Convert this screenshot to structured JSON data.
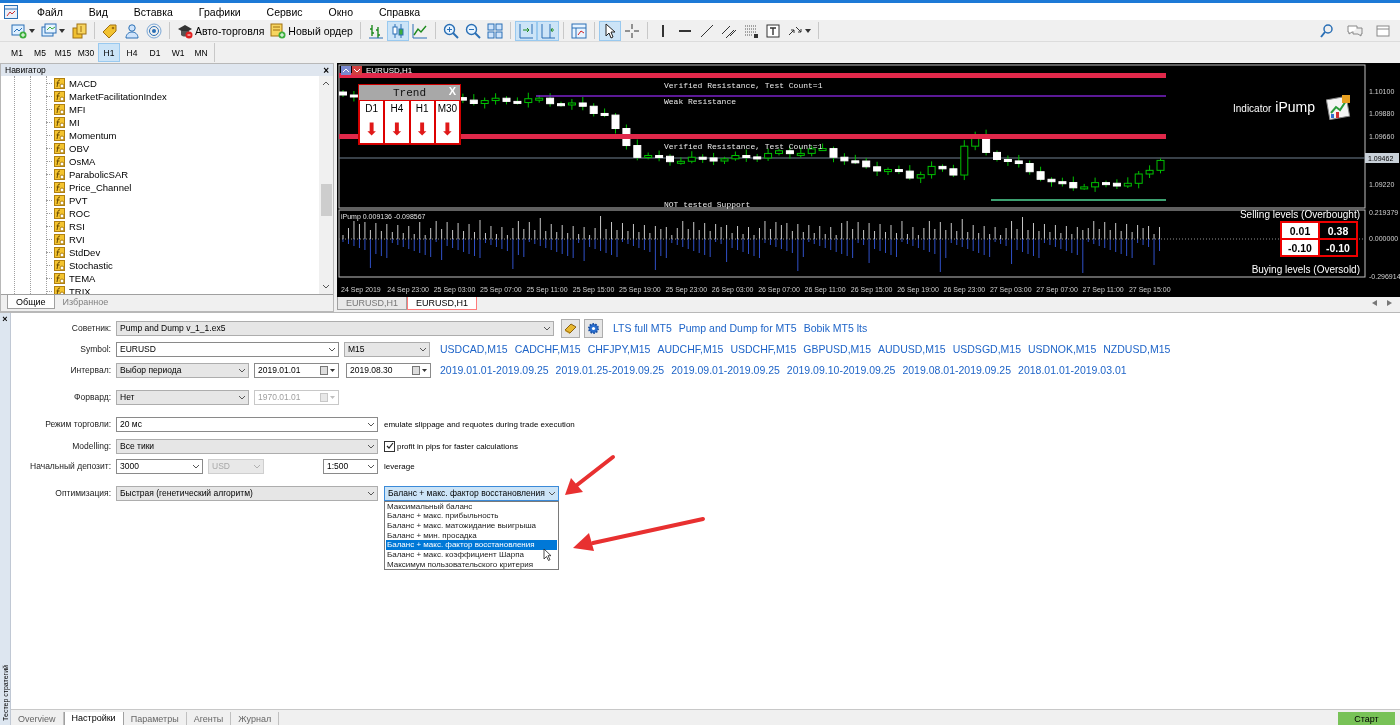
{
  "menu": {
    "items": [
      "Файл",
      "Вид",
      "Вставка",
      "Графики",
      "Сервис",
      "Окно",
      "Справка"
    ]
  },
  "toolbar": {
    "groups": [
      [
        {
          "kind": "new-chart",
          "selected": false
        },
        {
          "kind": "profiles",
          "selected": false
        },
        {
          "kind": "market",
          "selected": false
        }
      ],
      [
        {
          "kind": "signals",
          "selected": false
        },
        {
          "kind": "community",
          "selected": false
        },
        {
          "kind": "radio",
          "selected": false
        }
      ],
      [
        {
          "kind": "auto-trading",
          "label": "Авто-торговля",
          "selected": false
        },
        {
          "kind": "new-order",
          "label": "Новый ордер",
          "selected": false
        }
      ],
      [
        {
          "kind": "bar-chart",
          "selected": false
        },
        {
          "kind": "candles",
          "selected": true
        },
        {
          "kind": "line-chart",
          "selected": false
        }
      ],
      [
        {
          "kind": "zoom-in",
          "selected": false
        },
        {
          "kind": "zoom-out",
          "selected": false
        },
        {
          "kind": "tile",
          "selected": false
        }
      ],
      [
        {
          "kind": "autoscroll",
          "selected": true
        },
        {
          "kind": "chart-shift",
          "selected": true
        }
      ],
      [
        {
          "kind": "template",
          "selected": false
        }
      ],
      [
        {
          "kind": "cursor",
          "selected": true
        },
        {
          "kind": "crosshair",
          "selected": false
        }
      ],
      [
        {
          "kind": "vline",
          "selected": false
        },
        {
          "kind": "hline",
          "selected": false
        },
        {
          "kind": "trendline",
          "selected": false
        },
        {
          "kind": "channel",
          "selected": false
        },
        {
          "kind": "fibo",
          "selected": false
        },
        {
          "kind": "text-label",
          "selected": false
        },
        {
          "kind": "arrows",
          "selected": false
        }
      ]
    ],
    "right": [
      {
        "kind": "search",
        "selected": false
      },
      {
        "kind": "chat",
        "selected": false
      },
      {
        "kind": "window",
        "selected": false
      }
    ]
  },
  "timeframes": [
    {
      "label": "M1",
      "selected": false
    },
    {
      "label": "M5",
      "selected": false
    },
    {
      "label": "M15",
      "selected": false
    },
    {
      "label": "M30",
      "selected": false
    },
    {
      "label": "H1",
      "selected": true
    },
    {
      "label": "H4",
      "selected": false
    },
    {
      "label": "D1",
      "selected": false
    },
    {
      "label": "W1",
      "selected": false
    },
    {
      "label": "MN",
      "selected": false
    }
  ],
  "navigator": {
    "title": "Навигатор",
    "close": "×",
    "items": [
      "MACD",
      "MarketFacilitationIndex",
      "MFI",
      "MI",
      "Momentum",
      "OBV",
      "OsMA",
      "ParabolicSAR",
      "Price_Channel",
      "PVT",
      "ROC",
      "RSI",
      "RVI",
      "StdDev",
      "Stochastic",
      "TEMA",
      "TRIX"
    ],
    "tabs": [
      {
        "label": "Общие",
        "selected": true
      },
      {
        "label": "Избранное",
        "selected": false
      }
    ]
  },
  "chart": {
    "symbol": "EURUSD,H1",
    "levels": [
      {
        "kind": "verified-resistance",
        "label": "Verified Resistance, Test Count=1"
      },
      {
        "kind": "weak-resistance",
        "label": "Weak Resistance"
      },
      {
        "kind": "verified-resistance",
        "label": "Verified Resistance, Test Count=1"
      },
      {
        "kind": "support",
        "label": "NOT tested Support"
      }
    ],
    "price_ticks": [
      "1.10100",
      "1.09880",
      "1.09660",
      "1.09220"
    ],
    "current_price": "1.09462",
    "trend_panel": {
      "title": "Trend",
      "close": "X",
      "timeframes": [
        {
          "label": "D1",
          "arrow": "⬇"
        },
        {
          "label": "H4",
          "arrow": "⬇"
        },
        {
          "label": "H1",
          "arrow": "⬇"
        },
        {
          "label": "M30",
          "arrow": "⬇"
        }
      ]
    },
    "brand": {
      "text": "Indicator",
      "name": "iPump"
    },
    "indicator": {
      "title": "iPump 0.009136 -0.098567",
      "ticks": [
        "0.219379",
        "0.000000",
        "-0.296914"
      ],
      "selling_label": "Selling levels (Overbought)",
      "buying_label": "Buying levels (Oversold)",
      "levels": [
        [
          "0.01",
          "0.38"
        ],
        [
          "-0.10",
          "-0.10"
        ]
      ]
    },
    "time_labels": [
      "24 Sep 2019",
      "24 Sep 23:00",
      "25 Sep 03:00",
      "25 Sep 07:00",
      "25 Sep 11:00",
      "25 Sep 15:00",
      "25 Sep 19:00",
      "25 Sep 23:00",
      "26 Sep 03:00",
      "26 Sep 07:00",
      "26 Sep 11:00",
      "26 Sep 15:00",
      "26 Sep 19:00",
      "26 Sep 23:00",
      "27 Sep 03:00",
      "27 Sep 07:00",
      "27 Sep 11:00",
      "27 Sep 15:00"
    ],
    "tabs": [
      {
        "label": "EURUSD,H1",
        "selected": false
      },
      {
        "label": "EURUSD,H1",
        "selected": true
      }
    ]
  },
  "tester": {
    "close": "×",
    "title": "Тестер стратегий",
    "rows": [
      {
        "label": "Советник:",
        "items": [
          {
            "kind": "dropdown",
            "value": "Pump and Dump v_1_1.ex5",
            "disabled": false,
            "open": false
          },
          {
            "kind": "book-button"
          },
          {
            "kind": "gear-button"
          },
          {
            "kind": "link",
            "text": "LTS full MT5"
          },
          {
            "kind": "link",
            "text": "Pump and Dump for MT5"
          },
          {
            "kind": "link",
            "text": "Bobik MT5 lts"
          }
        ]
      },
      {
        "label": "Symbol:",
        "items": [
          {
            "kind": "combobox",
            "value": "EURUSD",
            "disabled": false,
            "open": false
          },
          {
            "kind": "dropdown",
            "value": "M15",
            "disabled": false,
            "open": false
          },
          {
            "kind": "link",
            "text": "USDCAD,M15"
          },
          {
            "kind": "link",
            "text": "CADCHF,M15"
          },
          {
            "kind": "link",
            "text": "CHFJPY,M15"
          },
          {
            "kind": "link",
            "text": "AUDCHF,M15"
          },
          {
            "kind": "link",
            "text": "USDCHF,M15"
          },
          {
            "kind": "link",
            "text": "GBPUSD,M15"
          },
          {
            "kind": "link",
            "text": "AUDUSD,M15"
          },
          {
            "kind": "link",
            "text": "USDSGD,M15"
          },
          {
            "kind": "link",
            "text": "USDNOK,M15"
          },
          {
            "kind": "link",
            "text": "NZDUSD,M15"
          }
        ]
      },
      {
        "label": "Интервал:",
        "items": [
          {
            "kind": "dropdown",
            "value": "Выбор периода",
            "disabled": false,
            "open": false
          },
          {
            "kind": "date",
            "value": "2019.01.01",
            "disabled": false
          },
          {
            "kind": "date",
            "value": "2019.08.30",
            "disabled": false
          },
          {
            "kind": "link",
            "text": "2019.01.01-2019.09.25"
          },
          {
            "kind": "link",
            "text": "2019.01.25-2019.09.25"
          },
          {
            "kind": "link",
            "text": "2019.09.01-2019.09.25"
          },
          {
            "kind": "link",
            "text": "2019.09.10-2019.09.25"
          },
          {
            "kind": "link",
            "text": "2019.08.01-2019.09.25"
          },
          {
            "kind": "link",
            "text": "2018.01.01-2019.03.01"
          }
        ]
      },
      {
        "label": "Форвард:",
        "items": [
          {
            "kind": "dropdown",
            "value": "Нет",
            "disabled": false,
            "open": false
          },
          {
            "kind": "date",
            "value": "1970.01.01",
            "disabled": true
          }
        ]
      },
      {
        "label": "Режим торговли:",
        "items": [
          {
            "kind": "combobox",
            "value": "20 мс",
            "disabled": false,
            "open": false
          },
          {
            "kind": "note",
            "text": "emulate slippage and requotes during trade execution"
          }
        ]
      },
      {
        "label": "Modelling:",
        "items": [
          {
            "kind": "dropdown",
            "value": "Все тики",
            "disabled": false,
            "open": false
          },
          {
            "kind": "checkbox",
            "label": "profit in pips for faster calculations",
            "checked": true
          }
        ]
      },
      {
        "label": "Начальный депозит:",
        "items": [
          {
            "kind": "combobox",
            "value": "3000",
            "disabled": false,
            "open": false
          },
          {
            "kind": "combobox",
            "value": "USD",
            "disabled": true,
            "open": false
          },
          {
            "kind": "combobox",
            "value": "1:500",
            "disabled": false,
            "open": false
          },
          {
            "kind": "note",
            "text": "leverage"
          }
        ]
      },
      {
        "label": "Оптимизация:",
        "items": [
          {
            "kind": "dropdown",
            "value": "Быстрая (генетический алгоритм)",
            "disabled": false,
            "open": false
          },
          {
            "kind": "dropdown",
            "value": "Баланс + макс. фактор восстановления",
            "disabled": false,
            "open": true,
            "options": [
              {
                "label": "Максимальный баланс",
                "selected": false
              },
              {
                "label": "Баланс + макс. прибыльность",
                "selected": false
              },
              {
                "label": "Баланс + макс. матожидание выигрыша",
                "selected": false
              },
              {
                "label": "Баланс + мин. просадка",
                "selected": false
              },
              {
                "label": "Баланс + макс. фактор восстановления",
                "selected": true
              },
              {
                "label": "Баланс + макс. коэффициент Шарпа",
                "selected": false
              },
              {
                "label": "Максимум пользовательского критерия",
                "selected": false
              }
            ]
          }
        ]
      }
    ],
    "tabs": [
      {
        "label": "Overview",
        "selected": false
      },
      {
        "label": "Настройки",
        "selected": true
      },
      {
        "label": "Параметры",
        "selected": false
      },
      {
        "label": "Агенты",
        "selected": false
      },
      {
        "label": "Журнал",
        "selected": false
      }
    ],
    "start": "Старт"
  }
}
